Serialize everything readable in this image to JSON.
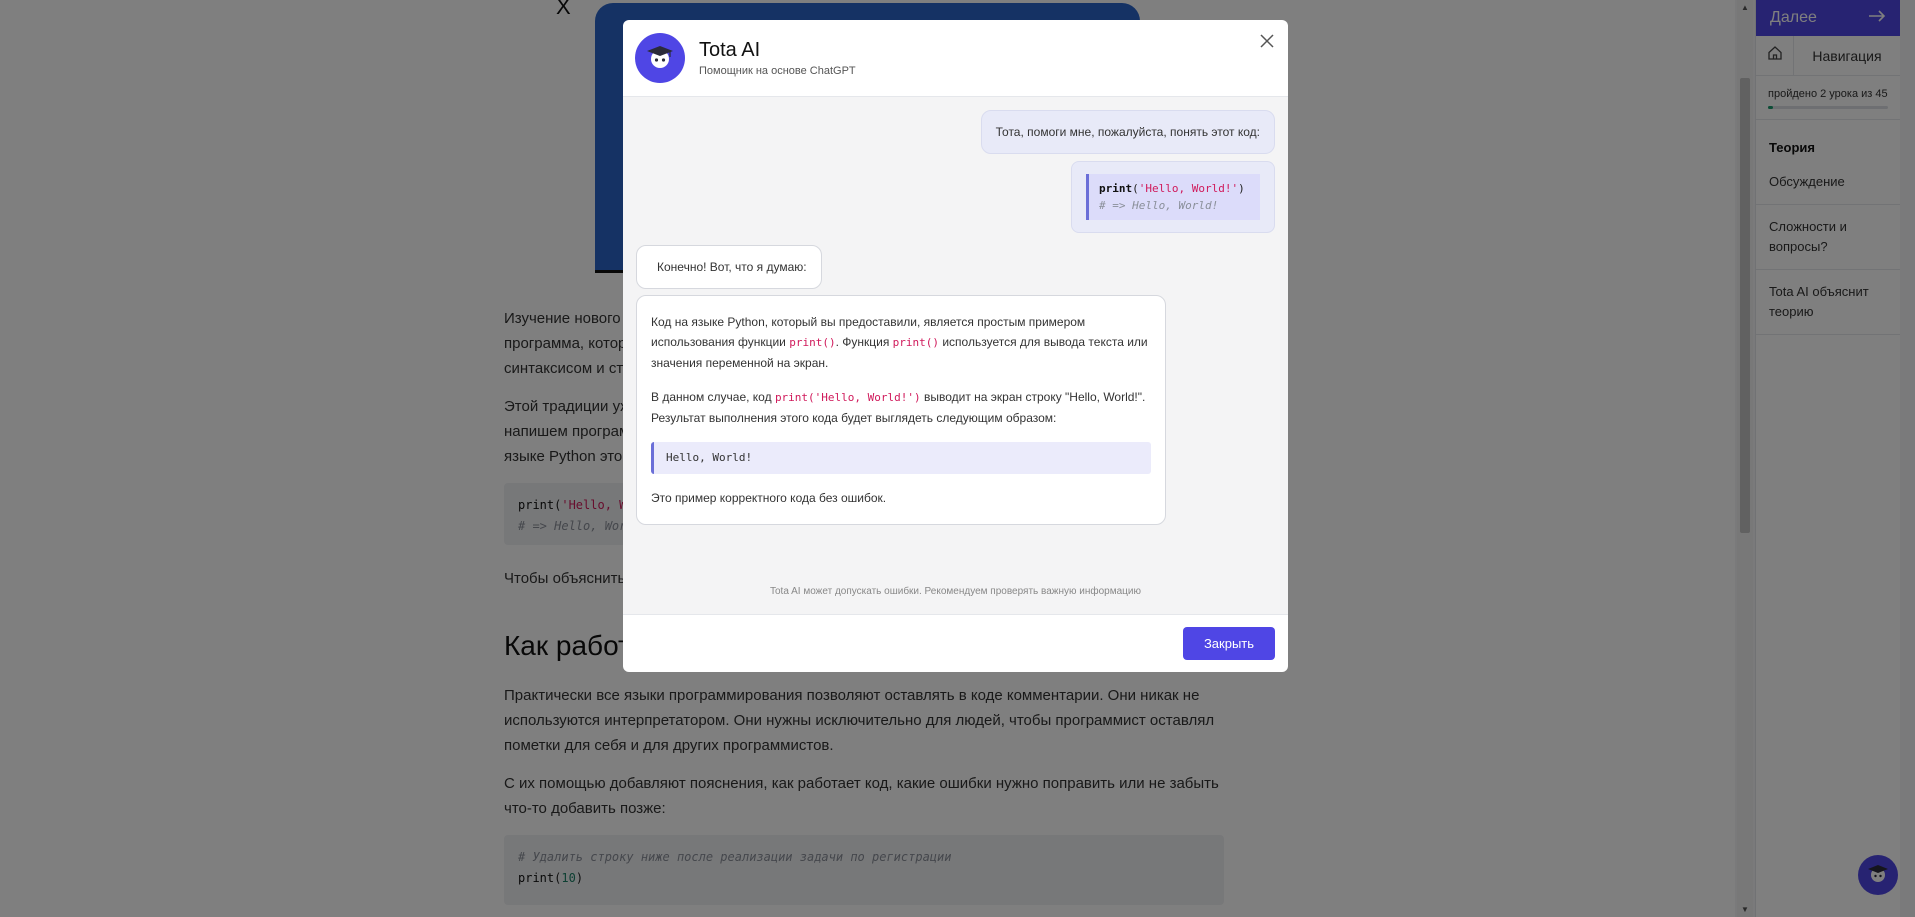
{
  "lesson": {
    "x_mark": "X",
    "para1_line1": "Изучение нового",
    "para1_line2": "программа, котор",
    "para1_line3": "синтаксисом и стр",
    "para2_line1": "Этой традиции уж",
    "para2_line2": "напишем програм",
    "para2_line3": "языке Python это",
    "code1_line1_fn": "print",
    "code1_line1_str": "'Hello, W",
    "code1_line2": "# => Hello, Worl",
    "para3": "Чтобы объяснить",
    "heading": "Как работ",
    "para4": "Практически все языки программирования позволяют оставлять в коде комментарии. Они никак не используются интерпретатором. Они нужны исключительно для людей, чтобы программист оставлял пометки для себя и для других программистов.",
    "para5": "С их помощью добавляют пояснения, как работает код, какие ошибки нужно поправить или не забыть что-то добавить позже:",
    "code2_comment": "# Удалить строку ниже после реализации задачи по регистрации",
    "code2_fn": "print",
    "code2_num": "10"
  },
  "sidebar": {
    "next_label": "Далее",
    "next_icon": "arrow-right-icon",
    "home_icon": "home-icon",
    "nav_label": "Навигация",
    "progress_text": "пройдено 2 урока из 45",
    "progress_fraction": 0.044,
    "progress_color": "#1a9b6c",
    "items": [
      {
        "label": "Теория"
      },
      {
        "label": "Обсуждение"
      },
      {
        "label": "Сложности и вопросы?"
      },
      {
        "label": "Tota AI объяснит теорию"
      }
    ]
  },
  "modal": {
    "title": "Tota AI",
    "subtitle": "Помощник на основе ChatGPT",
    "avatar_icon": "graduation-cap-robot-icon",
    "close_icon": "close-icon",
    "accent_color": "#4f46e5",
    "user_message": "Тота, помоги мне, пожалуйста, понять этот код:",
    "user_code_fn": "print",
    "user_code_str": "'Hello, World!'",
    "user_code_comment": "# => Hello, World!",
    "bot_short": "Конечно! Вот, что я думаю:",
    "bot_p1_a": "Код на языке Python, который вы предоставили, является простым примером использования функции ",
    "bot_p1_code1": "print()",
    "bot_p1_b": ". Функция ",
    "bot_p1_code2": "print()",
    "bot_p1_c": " используется для вывода текста или значения переменной на экран.",
    "bot_p2_a": "В данном случае, код ",
    "bot_p2_code": "print('Hello, World!')",
    "bot_p2_b": " выводит на экран строку \"Hello, World!\". Результат выполнения этого кода будет выглядеть следующим образом:",
    "bot_code_block": "Hello, World!",
    "bot_p3": "Это пример корректного кода без ошибок.",
    "disclaimer": "Tota AI может допускать ошибки. Рекомендуем проверять важную информацию",
    "close_button": "Закрыть"
  }
}
